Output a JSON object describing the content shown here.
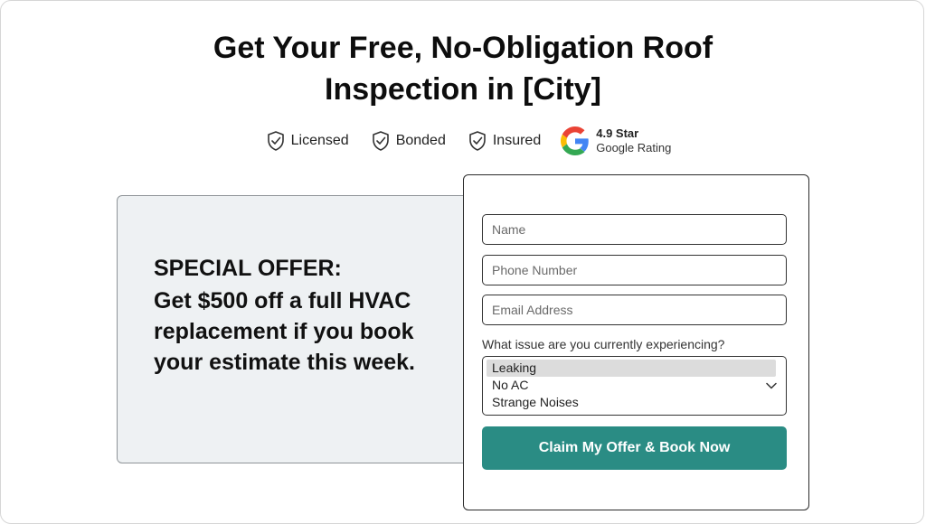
{
  "headline": {
    "line1": "Get Your Free, No-Obligation Roof",
    "line2": "Inspection in [City]"
  },
  "trust_badges": [
    {
      "label": "Licensed",
      "icon": "shield-check-icon"
    },
    {
      "label": "Bonded",
      "icon": "shield-check-icon"
    },
    {
      "label": "Insured",
      "icon": "shield-check-icon"
    }
  ],
  "rating": {
    "icon": "google-g-icon",
    "stars_text": "4.9 Star",
    "label": "Google Rating"
  },
  "offer": {
    "title": "SPECIAL OFFER:",
    "text": "Get $500 off a full HVAC replacement if you book your estimate this week."
  },
  "form": {
    "name_placeholder": "Name",
    "phone_placeholder": "Phone Number",
    "email_placeholder": "Email Address",
    "issue_question": "What issue are you currently experiencing?",
    "issue_options": [
      "Leaking",
      "No AC",
      "Strange Noises"
    ],
    "selected_issue": "Leaking",
    "submit_label": "Claim My Offer & Book Now"
  },
  "colors": {
    "cta": "#2a8c84",
    "offer_bg": "#eef1f3",
    "google_blue": "#4285F4",
    "google_red": "#EA4335",
    "google_yellow": "#FBBC05",
    "google_green": "#34A853"
  }
}
